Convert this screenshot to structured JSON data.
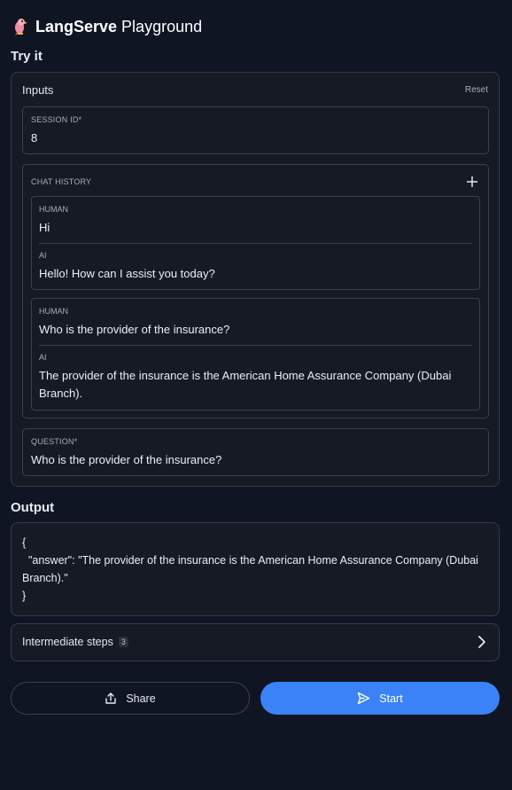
{
  "header": {
    "brand_bold": "LangServe",
    "brand_light": "Playground"
  },
  "try_it": {
    "title": "Try it"
  },
  "inputs": {
    "label": "Inputs",
    "reset_label": "Reset",
    "session_id": {
      "label": "SESSION ID*",
      "value": "8"
    },
    "chat_history": {
      "label": "CHAT HISTORY",
      "groups": [
        {
          "human_role": "HUMAN",
          "human_text": "Hi",
          "ai_role": "AI",
          "ai_text": "Hello! How can I assist you today?"
        },
        {
          "human_role": "HUMAN",
          "human_text": "Who is the provider of the insurance?",
          "ai_role": "AI",
          "ai_text": "The provider of the insurance is the American Home Assurance Company (Dubai Branch)."
        }
      ]
    },
    "question": {
      "label": "QUESTION*",
      "value": "Who is the provider of the insurance?"
    }
  },
  "output": {
    "title": "Output",
    "text": "{\n  \"answer\": \"The provider of the insurance is the American Home Assurance Company (Dubai Branch).\"\n}"
  },
  "intermediate": {
    "label": "Intermediate steps",
    "count": "3"
  },
  "actions": {
    "share_label": "Share",
    "start_label": "Start"
  },
  "colors": {
    "background": "#0f1523",
    "panel": "#161a24",
    "border": "#353b49",
    "accent": "#3b82f6"
  },
  "icons": {
    "logo": "parrot-logo",
    "plus": "plus-icon",
    "chevron": "chevron-right-icon",
    "share": "share-icon",
    "start": "send-icon"
  }
}
